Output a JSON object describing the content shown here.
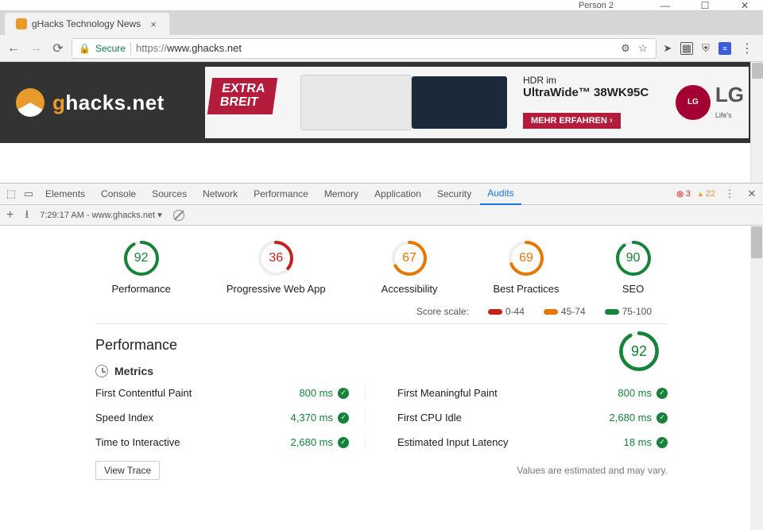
{
  "window": {
    "profile": "Person 2"
  },
  "browser": {
    "tab_title": "gHacks Technology News",
    "secure_label": "Secure",
    "url_proto": "https://",
    "url_host": "www.ghacks.net"
  },
  "page": {
    "logo_accent": "g",
    "logo_rest": "hacks.net",
    "ad": {
      "badge_line1": "EXTRA",
      "badge_line2": "BREIT",
      "text_line1": "HDR im",
      "text_line2": "UltraWide™ 38WK95C",
      "cta": "MEHR ERFAHREN ›",
      "brand": "LG",
      "brand_sub": "Life's"
    }
  },
  "devtools": {
    "tabs": [
      "Elements",
      "Console",
      "Sources",
      "Network",
      "Performance",
      "Memory",
      "Application",
      "Security",
      "Audits"
    ],
    "active_tab": "Audits",
    "errors": "3",
    "warnings": "22",
    "subbar_label": "7:29:17 AM - www.ghacks.net"
  },
  "audits": {
    "scores": [
      {
        "label": "Performance",
        "value": "92",
        "tone": "green",
        "pct": 92
      },
      {
        "label": "Progressive Web App",
        "value": "36",
        "tone": "red",
        "pct": 36
      },
      {
        "label": "Accessibility",
        "value": "67",
        "tone": "orange",
        "pct": 67
      },
      {
        "label": "Best Practices",
        "value": "69",
        "tone": "orange",
        "pct": 69
      },
      {
        "label": "SEO",
        "value": "90",
        "tone": "green",
        "pct": 90
      }
    ],
    "scale_label": "Score scale:",
    "scale": [
      {
        "range": "0-44",
        "tone": "red"
      },
      {
        "range": "45-74",
        "tone": "orange"
      },
      {
        "range": "75-100",
        "tone": "green"
      }
    ],
    "section_title": "Performance",
    "section_score": {
      "value": "92",
      "tone": "green",
      "pct": 92
    },
    "metrics_label": "Metrics",
    "metrics": [
      {
        "name": "First Contentful Paint",
        "value": "800 ms"
      },
      {
        "name": "First Meaningful Paint",
        "value": "800 ms"
      },
      {
        "name": "Speed Index",
        "value": "4,370 ms"
      },
      {
        "name": "First CPU Idle",
        "value": "2,680 ms"
      },
      {
        "name": "Time to Interactive",
        "value": "2,680 ms"
      },
      {
        "name": "Estimated Input Latency",
        "value": "18 ms"
      }
    ],
    "view_trace": "View Trace",
    "estimate_note": "Values are estimated and may vary."
  }
}
